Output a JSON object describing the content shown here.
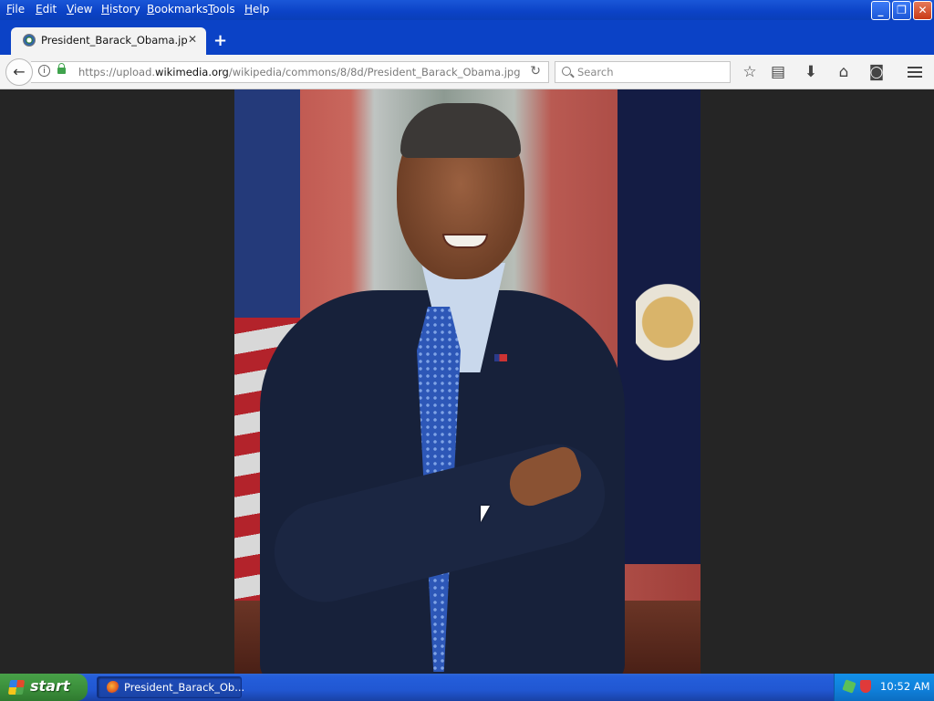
{
  "menu": {
    "items": [
      "File",
      "Edit",
      "View",
      "History",
      "Bookmarks",
      "Tools",
      "Help"
    ]
  },
  "window": {
    "minimize_label": "_",
    "restore_label": "❐",
    "close_label": "✕"
  },
  "tab": {
    "title": "President_Barack_Obama.jpg...",
    "close_glyph": "✕",
    "new_tab_glyph": "+"
  },
  "navbar": {
    "url_prefix": "https://upload.",
    "url_host": "wikimedia.org",
    "url_path": "/wikipedia/commons/8/8d/President_Barack_Obama.jpg",
    "search_placeholder": "Search"
  },
  "taskbar": {
    "start_label": "start",
    "task_label": "President_Barack_Ob...",
    "clock": "10:52 AM"
  },
  "colors": {
    "xp_blue": "#0b42c6",
    "start_green": "#3b8f3b",
    "viewer_background": "#252525"
  }
}
